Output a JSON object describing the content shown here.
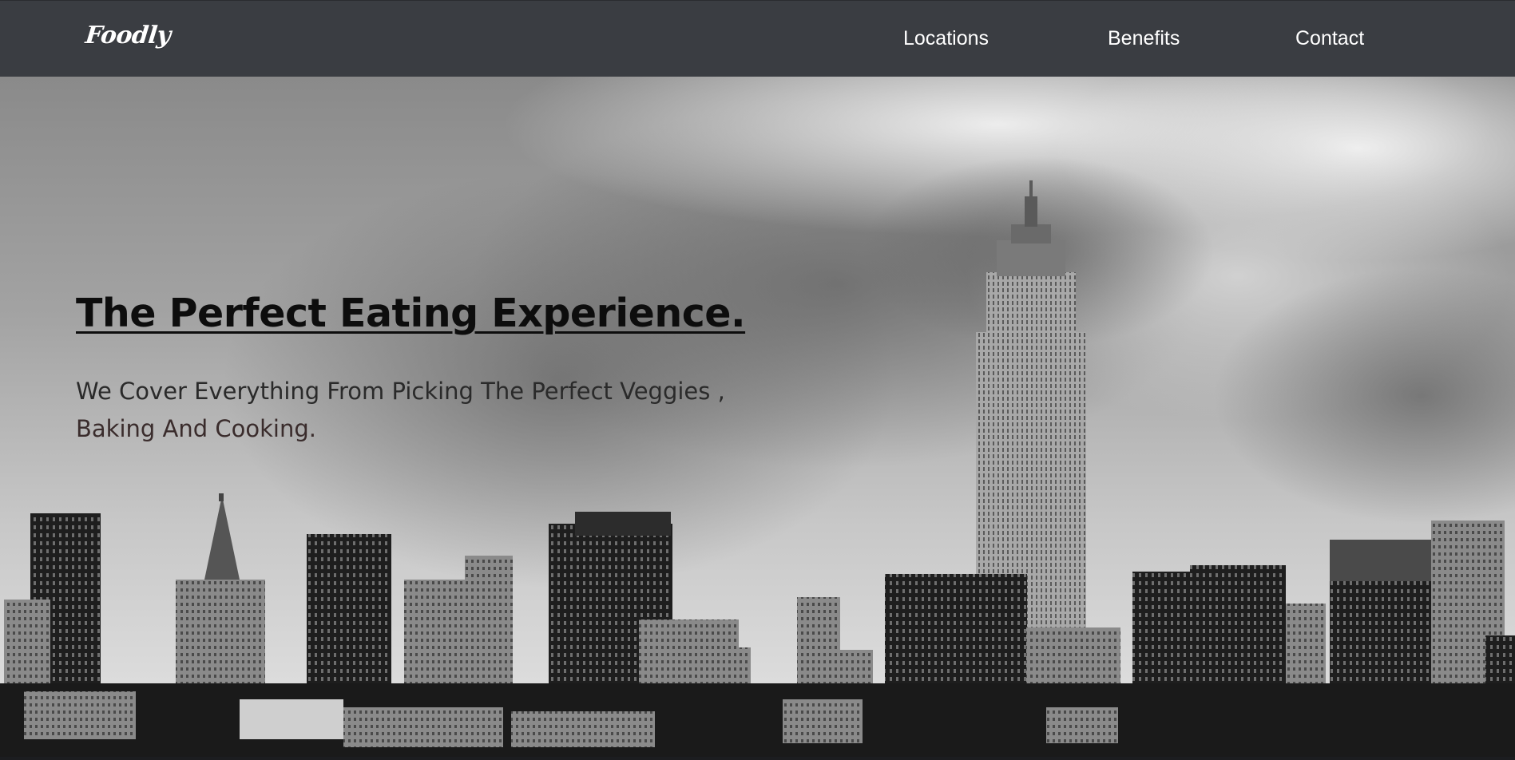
{
  "nav": {
    "logo": "Foodly",
    "links": [
      "Locations",
      "Benefits",
      "Contact"
    ]
  },
  "hero": {
    "title": "The Perfect Eating Experience.",
    "subtitle_line1": "We Cover Everything From Picking The Perfect Veggies ,",
    "subtitle_line2": "Baking And Cooking.",
    "background_image": "black-and-white-city-skyline-with-clouds"
  },
  "colors": {
    "navbar": "#3a3d42",
    "nav_text": "#ffffff",
    "title_text": "#0d0d0d",
    "subtitle_text": "#2a2a2a"
  }
}
